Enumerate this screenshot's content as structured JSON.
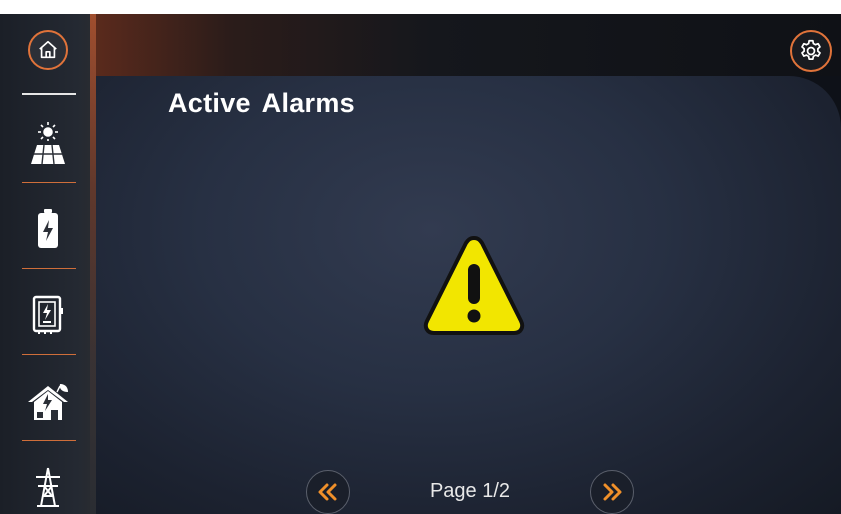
{
  "header": {
    "title": "Active Alarms",
    "home_icon": "home-icon",
    "settings_icon": "gear-icon"
  },
  "sidebar": {
    "items": [
      {
        "id": "solar",
        "icon": "solar-panel-icon"
      },
      {
        "id": "battery",
        "icon": "battery-icon"
      },
      {
        "id": "inverter",
        "icon": "inverter-icon"
      },
      {
        "id": "home-load",
        "icon": "eco-house-icon"
      },
      {
        "id": "grid",
        "icon": "power-tower-icon"
      }
    ]
  },
  "main": {
    "status_icon": "warning-icon"
  },
  "pagination": {
    "label": "Page 1/2",
    "prev_icon": "double-chevron-left-icon",
    "next_icon": "double-chevron-right-icon"
  },
  "colors": {
    "accent": "#e0733a",
    "warning_fill": "#f2e600",
    "background": "#222a3a"
  }
}
